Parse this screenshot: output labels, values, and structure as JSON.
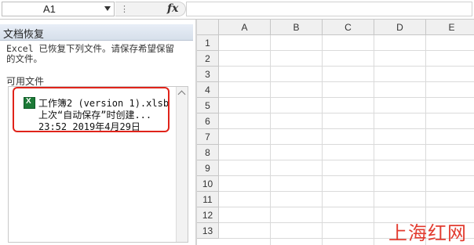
{
  "formula_bar": {
    "name_box": "A1",
    "fx_label": "fx",
    "formula": ""
  },
  "recovery_pane": {
    "title": "文档恢复",
    "message_line1": "Excel 已恢复下列文件。请保存希望保留",
    "message_line2": "的文件。",
    "available_label": "可用文件",
    "file": {
      "name": "工作簿2 (version 1).xlsb",
      "status": "上次“自动保存”时创建...",
      "time": "23:52 2019年4月29日"
    }
  },
  "sheet": {
    "columns": [
      "A",
      "B",
      "C",
      "D",
      "E"
    ],
    "rows": [
      "1",
      "2",
      "3",
      "4",
      "5",
      "6",
      "7",
      "8",
      "9",
      "10",
      "11",
      "12",
      "13"
    ]
  },
  "watermark": "上海红网",
  "colors": {
    "highlight": "#e0231a",
    "excel_green": "#1d7a37",
    "watermark": "#e23b2f"
  }
}
